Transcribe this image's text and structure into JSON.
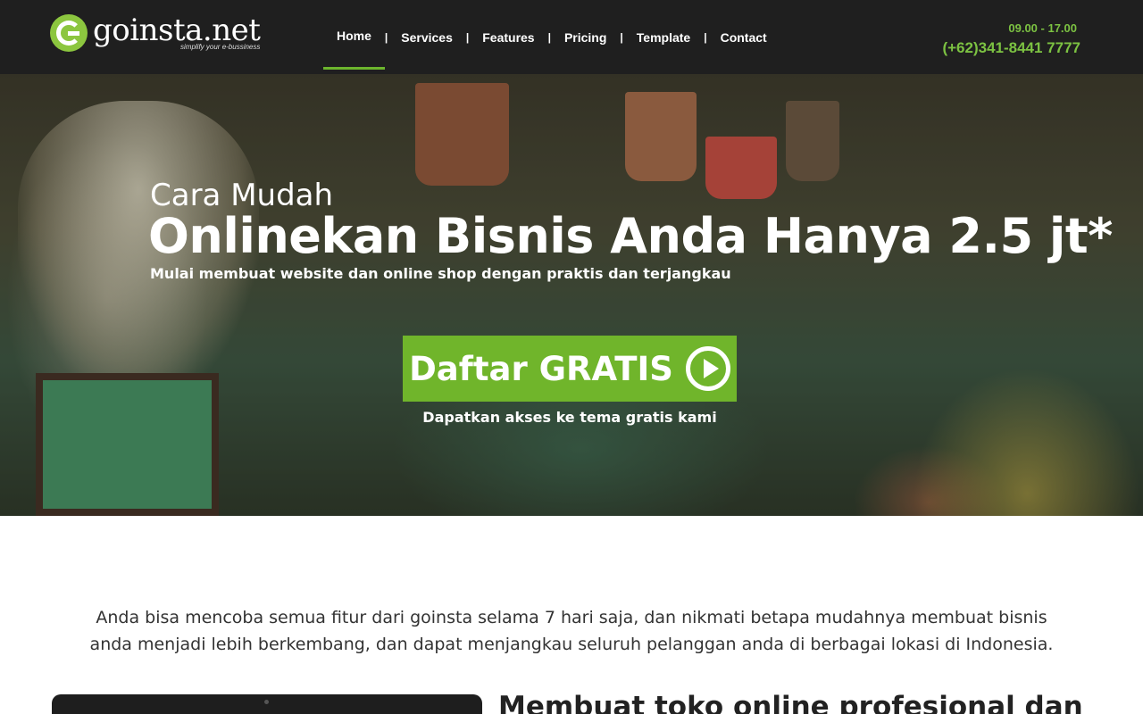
{
  "brand": {
    "name": "goinsta.net",
    "tagline": "simplify your e-bussiness"
  },
  "nav": {
    "items": [
      {
        "label": "Home",
        "active": true
      },
      {
        "label": "Services"
      },
      {
        "label": "Features"
      },
      {
        "label": "Pricing"
      },
      {
        "label": "Template"
      },
      {
        "label": "Contact"
      }
    ],
    "separator": "|"
  },
  "contact": {
    "hours": "09.00 - 17.00",
    "phone": "(+62)341-8441 7777"
  },
  "hero": {
    "pre_title": "Cara Mudah",
    "title": "Onlinekan Bisnis Anda Hanya 2.5 jt*",
    "subtitle": "Mulai membuat website dan online shop dengan praktis dan terjangkau",
    "cta_label": "Daftar GRATIS",
    "cta_icon": "play-circle-icon",
    "cta_note": "Dapatkan akses ke tema gratis kami"
  },
  "intro": {
    "text": "Anda bisa mencoba semua fitur dari goinsta selama 7 hari saja, dan nikmati betapa mudahnya membuat bisnis anda menjadi lebih berkembang, dan dapat menjangkau seluruh pelanggan anda di berbagai lokasi di Indonesia."
  },
  "section": {
    "title": "Membuat toko online profesional dan"
  },
  "colors": {
    "accent": "#70b52b",
    "header_bg": "#1f1f1f",
    "contact_text": "#7cc242"
  }
}
